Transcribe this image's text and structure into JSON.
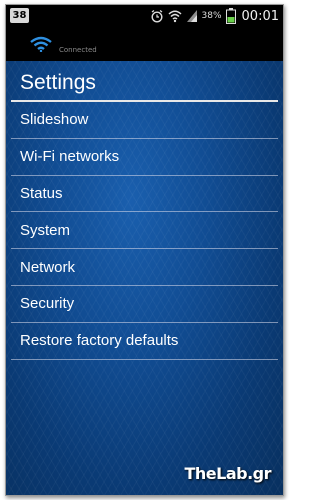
{
  "status_bar": {
    "notification_badge": "38",
    "battery_percent": "38%",
    "time": "00:01",
    "icons": [
      "alarm-icon",
      "wifi-icon",
      "signal-icon",
      "battery-icon"
    ]
  },
  "connection": {
    "label": "Connected",
    "icon": "wifi-icon"
  },
  "page": {
    "title": "Settings"
  },
  "menu": {
    "items": [
      {
        "label": "Slideshow"
      },
      {
        "label": "Wi-Fi networks"
      },
      {
        "label": "Status"
      },
      {
        "label": "System"
      },
      {
        "label": "Network"
      },
      {
        "label": "Security"
      },
      {
        "label": "Restore factory defaults"
      }
    ]
  },
  "watermark": {
    "text": "TheLab.gr"
  },
  "colors": {
    "background_blue": "#0a3d78",
    "status_bar": "#000000",
    "text": "#ffffff"
  }
}
